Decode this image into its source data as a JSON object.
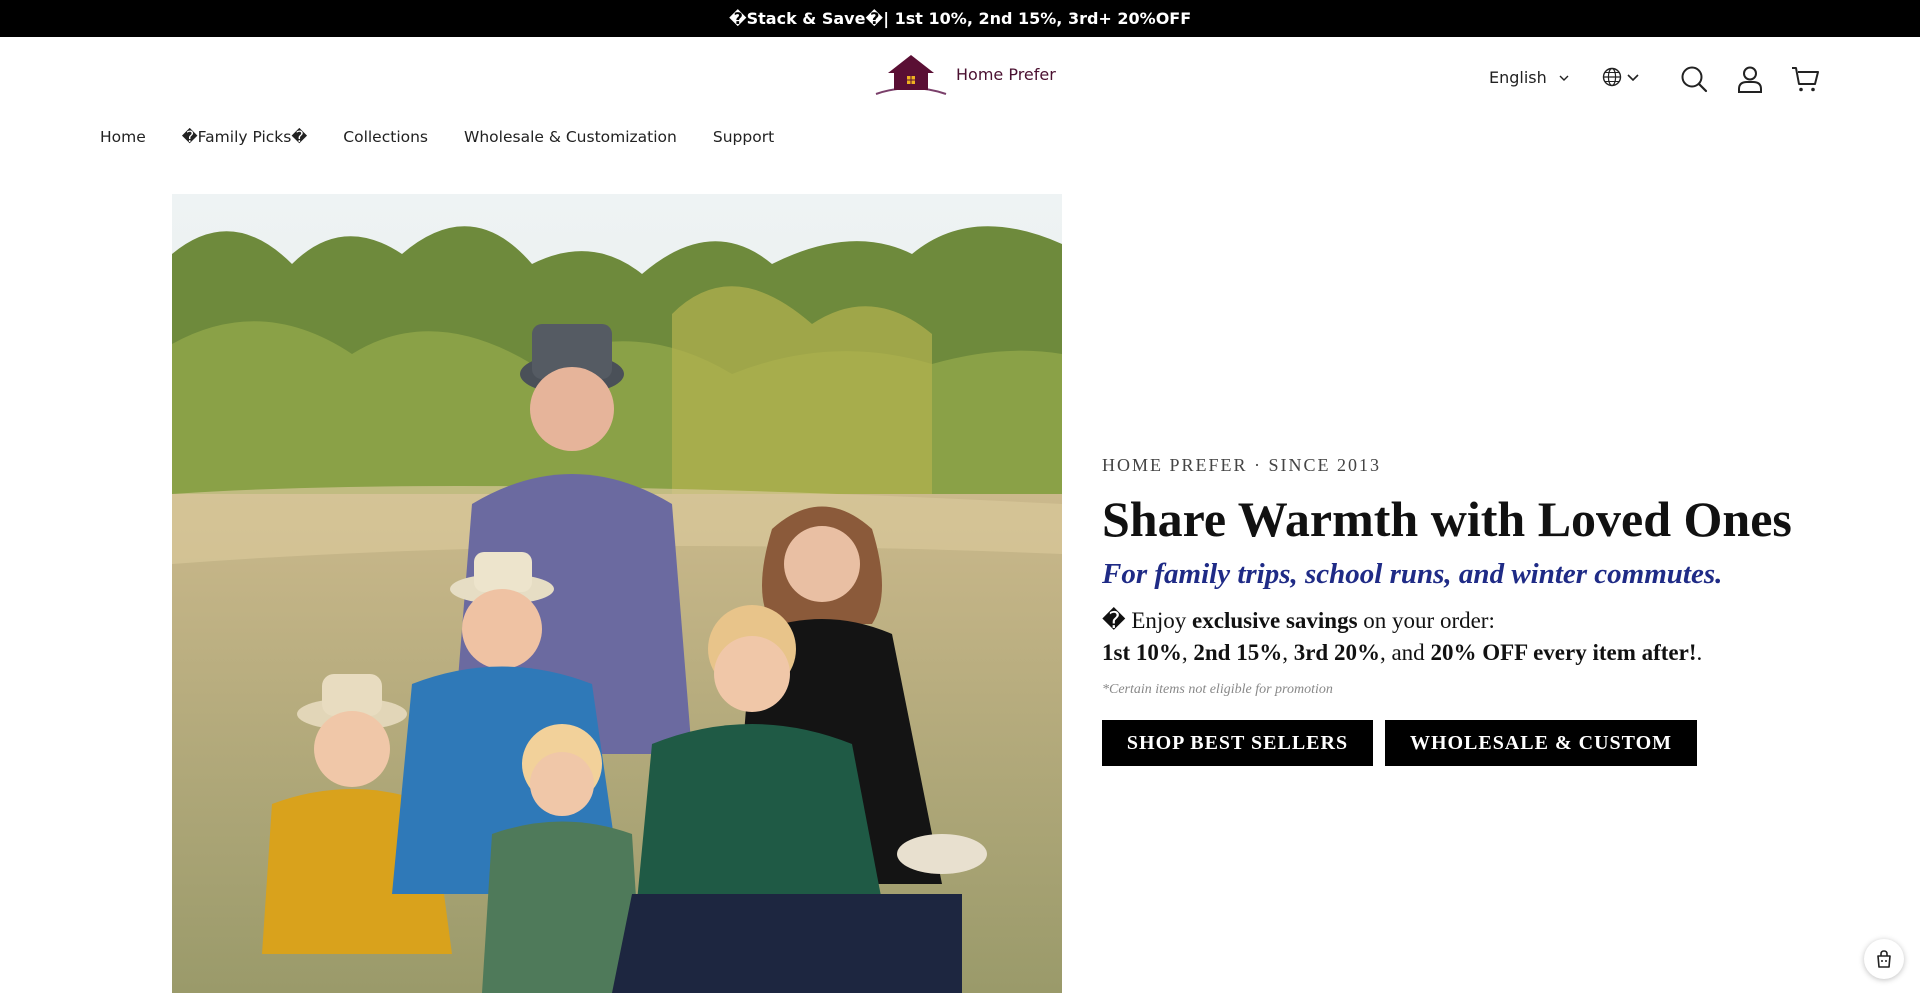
{
  "announcement": {
    "text": "�Stack & Save�| 1st 10%, 2nd 15%, 3rd+ 20%OFF"
  },
  "header": {
    "logo_text": "Home Prefer",
    "language": "English",
    "icons": [
      "globe-icon",
      "search-icon",
      "account-icon",
      "cart-icon"
    ]
  },
  "nav": {
    "items": [
      {
        "label": "Home"
      },
      {
        "label": "�Family Picks�"
      },
      {
        "label": "Collections"
      },
      {
        "label": "Wholesale & Customization"
      },
      {
        "label": "Support"
      }
    ]
  },
  "hero": {
    "eyebrow": "HOME PREFER · SINCE 2013",
    "headline": "Share Warmth with Loved Ones",
    "tagline": "For family trips, school runs, and winter commutes.",
    "offer": {
      "lead_icon": "�",
      "enjoy": "Enjoy",
      "savings_bold": "exclusive savings",
      "on_order": "on your order:",
      "tier1": "1st 10%",
      "tier2": "2nd 15%",
      "tier3": "3rd 20%",
      "and_text": "and",
      "tier_after": "20% OFF every item after!",
      "sep": ",",
      "end": "."
    },
    "note": "*Certain items not eligible for promotion",
    "button_primary": "SHOP BEST SELLERS",
    "button_secondary": "WHOLESALE & CUSTOM"
  },
  "colors": {
    "announcement_bg": "#000000",
    "brand_maroon": "#4a1030",
    "tagline_blue": "#1f2b86",
    "button_bg": "#000000"
  }
}
